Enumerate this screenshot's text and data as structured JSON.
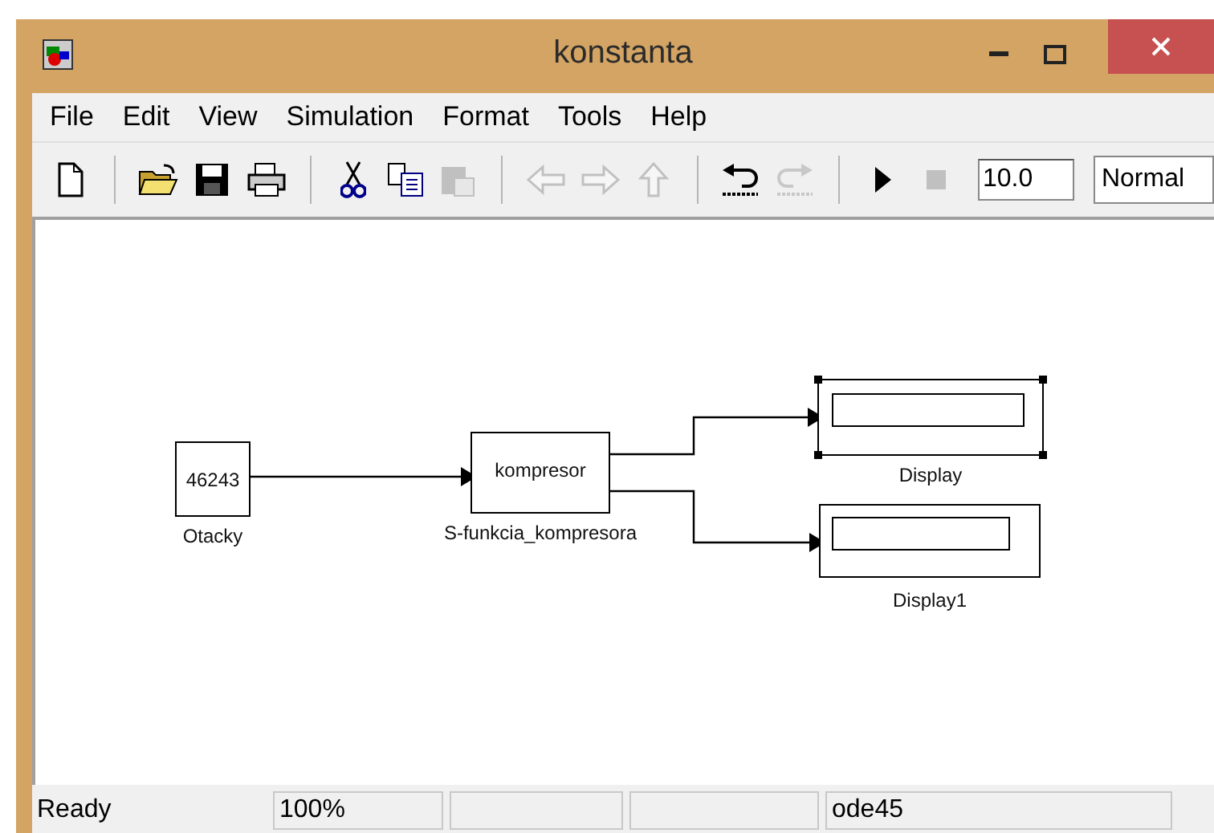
{
  "window": {
    "title": "konstanta"
  },
  "menu": [
    "File",
    "Edit",
    "View",
    "Simulation",
    "Format",
    "Tools",
    "Help"
  ],
  "toolbar": {
    "groups": [
      [
        {
          "kind": "new",
          "disabled": false
        }
      ],
      [
        {
          "kind": "open",
          "disabled": false
        },
        {
          "kind": "save",
          "disabled": false
        },
        {
          "kind": "print",
          "disabled": false
        }
      ],
      [
        {
          "kind": "cut",
          "disabled": false
        },
        {
          "kind": "copy",
          "disabled": false
        },
        {
          "kind": "paste",
          "disabled": true
        }
      ],
      [
        {
          "kind": "back",
          "disabled": true
        },
        {
          "kind": "forward",
          "disabled": true
        },
        {
          "kind": "up",
          "disabled": true
        }
      ],
      [
        {
          "kind": "undo",
          "disabled": false
        },
        {
          "kind": "redo",
          "disabled": true
        }
      ],
      [
        {
          "kind": "run",
          "disabled": false
        },
        {
          "kind": "stop",
          "disabled": true
        }
      ]
    ],
    "stop_time": "10.0",
    "mode": "Normal"
  },
  "diagram": {
    "blocks": [
      {
        "kind": "constant",
        "text": "46243",
        "label": "Otacky",
        "selected": false
      },
      {
        "kind": "sfunction",
        "text": "kompresor",
        "label": "S-funkcia_kompresora",
        "selected": false
      },
      {
        "kind": "display",
        "label": "Display",
        "selected": true
      },
      {
        "kind": "display",
        "label": "Display1",
        "selected": false
      }
    ]
  },
  "status_bar": {
    "message": "Ready",
    "zoom": "100%",
    "solver": "ode45"
  }
}
